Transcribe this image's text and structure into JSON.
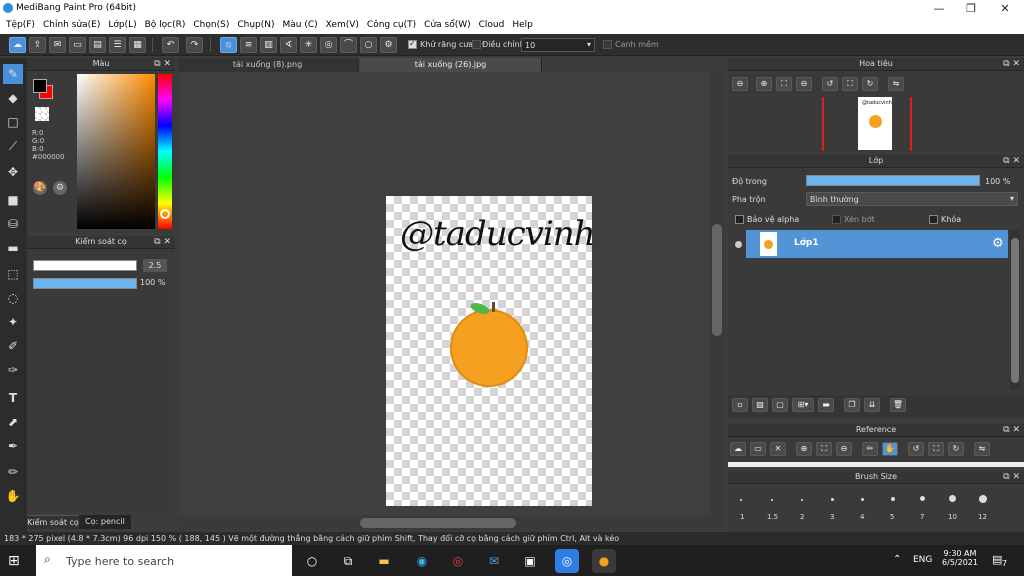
{
  "window": {
    "title": "MediBang Paint Pro (64bit)",
    "min": "—",
    "max": "❐",
    "close": "✕"
  },
  "menu": [
    "Tệp(F)",
    "Chỉnh sửa(E)",
    "Lớp(L)",
    "Bộ lọc(R)",
    "Chọn(S)",
    "Chụp(N)",
    "Màu (C)",
    "Xem(V)",
    "Công cụ(T)",
    "Cửa sổ(W)",
    "Cloud",
    "Help"
  ],
  "toolbar": {
    "antialias_label": "Khử răng cưa",
    "adjust_label": "Điều chỉnh",
    "adjust_value": "10",
    "smooth_label": "Canh mềm"
  },
  "color_panel": {
    "title": "Màu",
    "r": "R:0",
    "g": "G:0",
    "b": "B:0",
    "hex": "#000000",
    "primary": "#000000",
    "secondary": "#ff0000"
  },
  "brush_control": {
    "title": "Kiểm soát cọ",
    "size": "2.5",
    "opacity": "100 %",
    "opacity_level": 1.0
  },
  "bottom_tabs": {
    "tab1": "Kiểm soát cọ",
    "tab2": "Cọ: pencil"
  },
  "doc_tabs": [
    "tải xuống (8).png",
    "tải xuống (26).jpg"
  ],
  "canvas": {
    "signature": "@taducvinh",
    "fruit_color": "#f5a020"
  },
  "navigator": {
    "title": "Hoa tiêu"
  },
  "layers": {
    "title": "Lớp",
    "opacity_label": "Độ trong",
    "opacity_value": "100 %",
    "blend_label": "Pha trộn",
    "blend_value": "Bình thường",
    "protect_alpha": "Bảo vệ alpha",
    "clip": "Xén bớt",
    "lock": "Khóa",
    "layer_name": "Lớp1"
  },
  "reference": {
    "title": "Reference"
  },
  "brush_size": {
    "title": "Brush Size",
    "sizes": [
      "1",
      "1.5",
      "2",
      "3",
      "4",
      "5",
      "7",
      "10",
      "12"
    ]
  },
  "status": "183 * 275 pixel   (4.8 * 7.3cm)   96 dpi   150 %   ( 188, 145 )   Vẽ một đường thẳng bằng cách giữ phím Shift, Thay đổi cỡ cọ bằng cách giữ phím Ctrl, Alt và kéo",
  "taskbar": {
    "search_placeholder": "Type here to search",
    "lang": "ENG",
    "time": "9:30 AM",
    "date": "6/5/2021",
    "notif": "7"
  }
}
